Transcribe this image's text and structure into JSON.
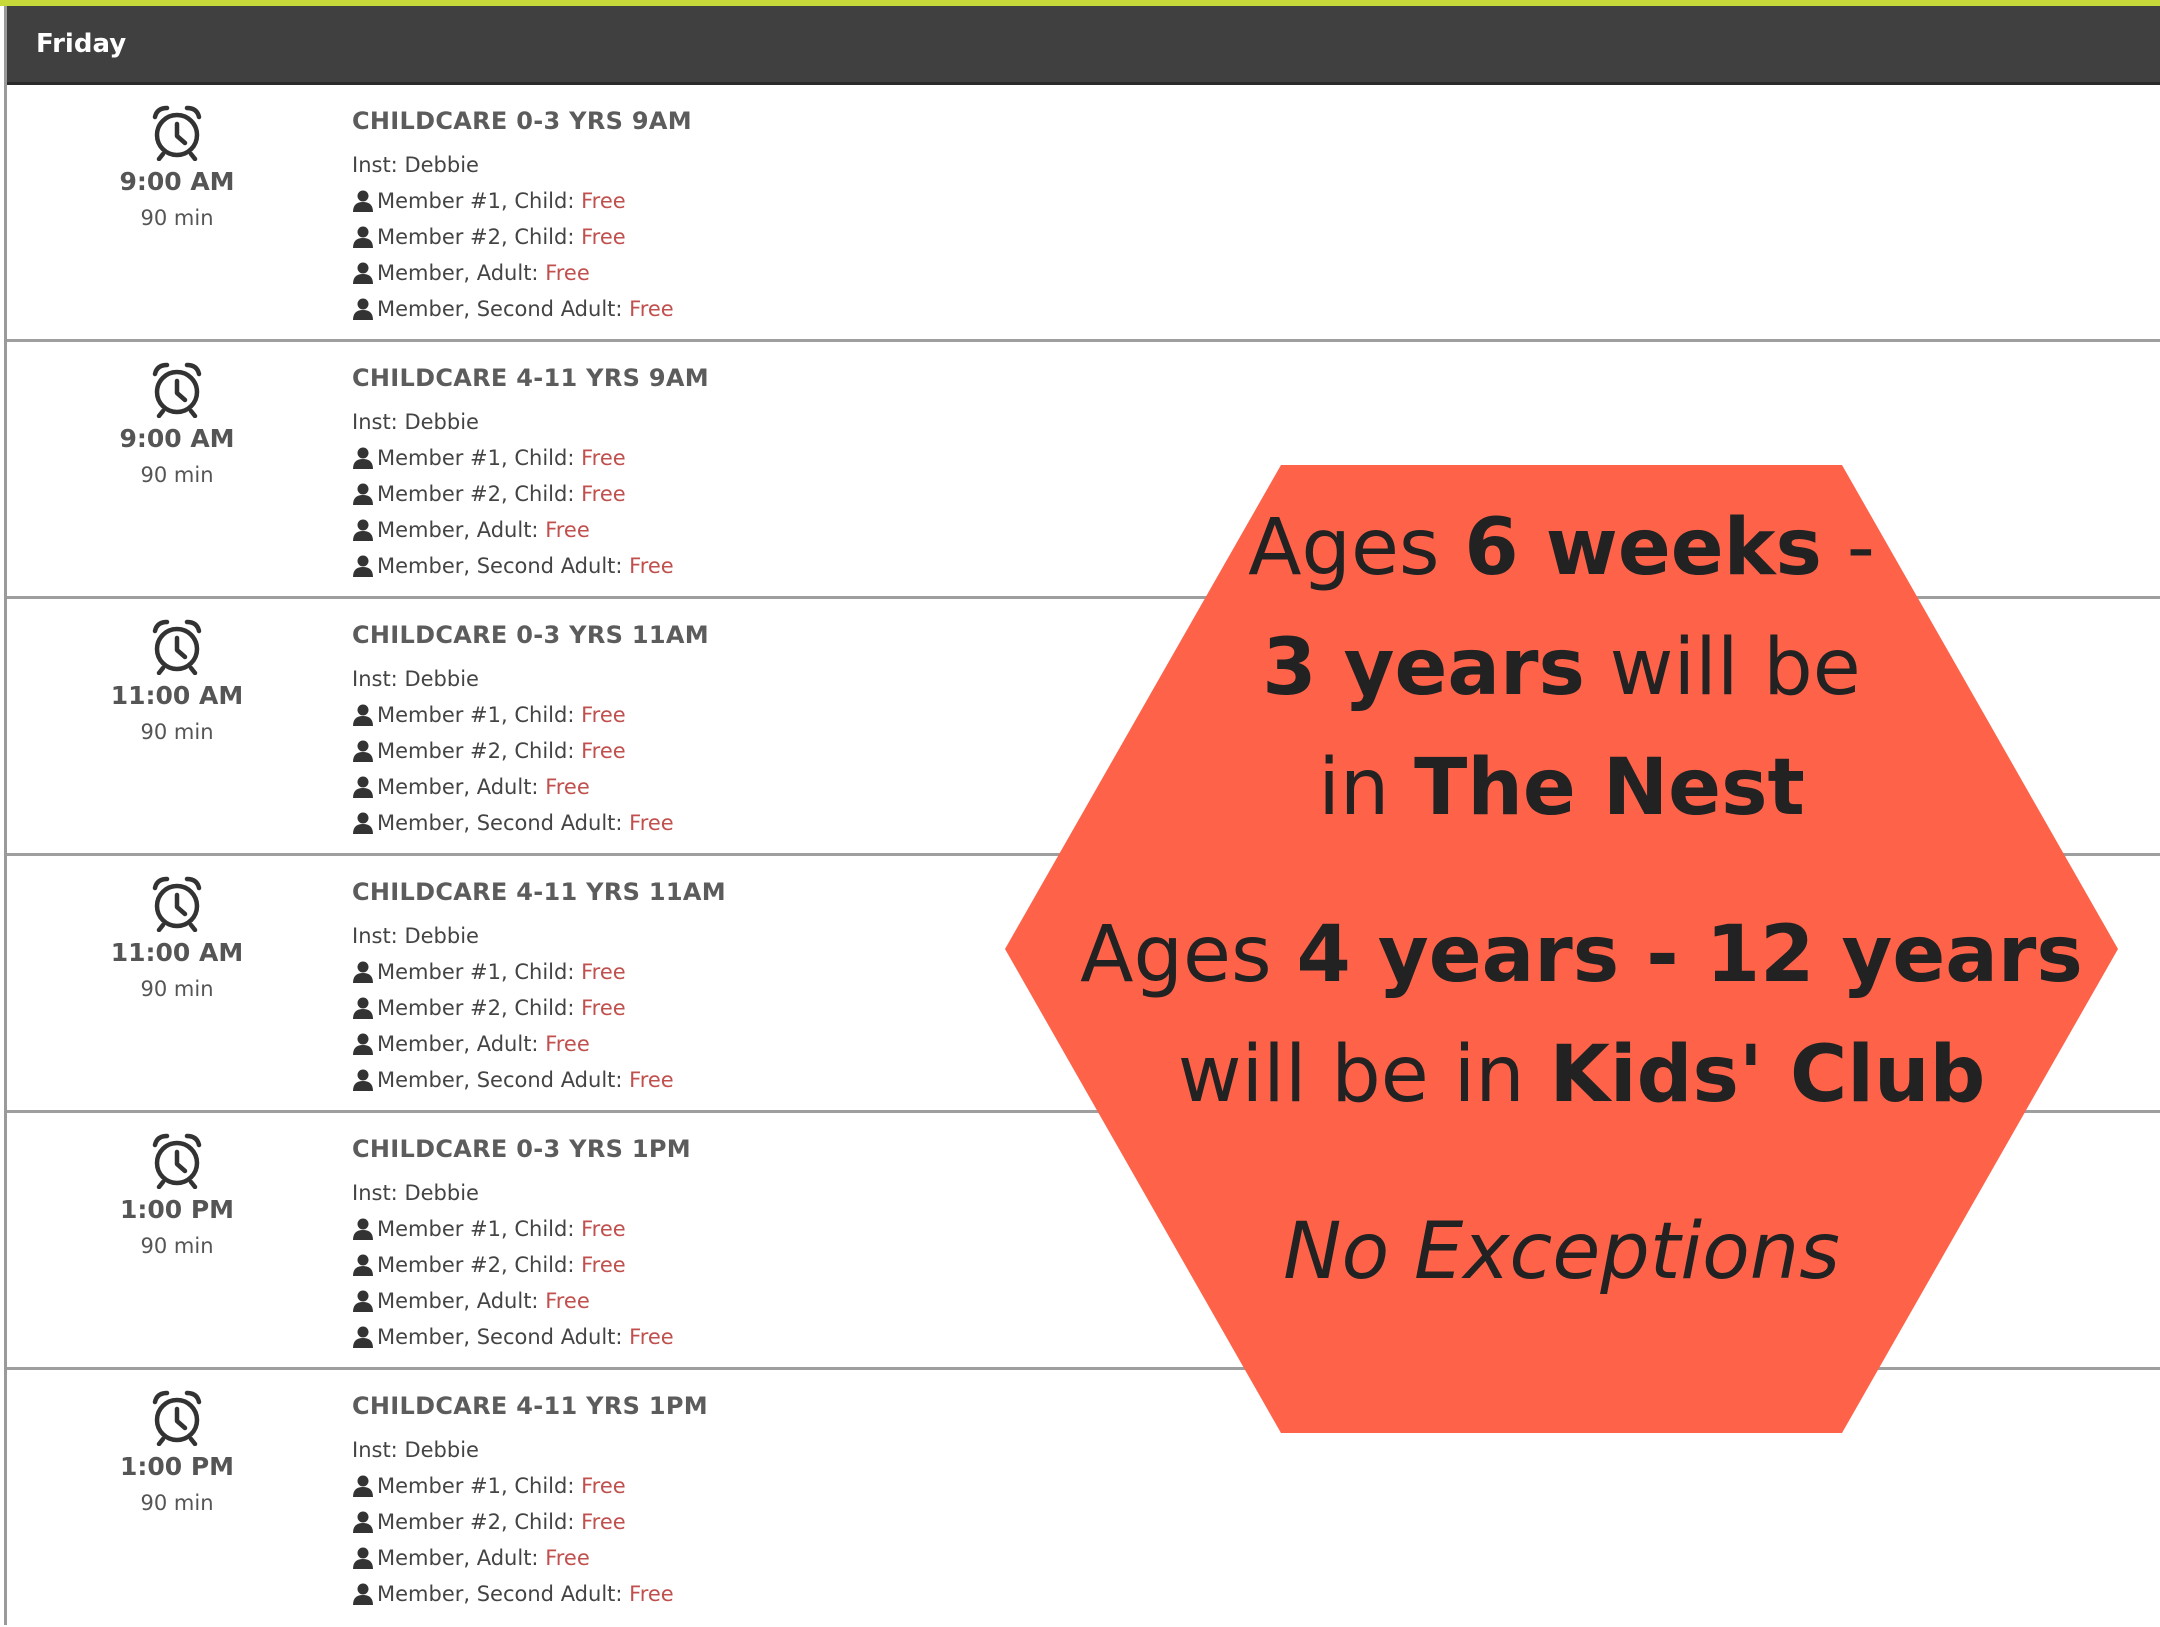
{
  "day": "Friday",
  "price_label": "Free",
  "instructor_prefix": "Inst:",
  "classes": [
    {
      "title": "CHILDCARE 0-3 YRS 9AM",
      "time": "9:00 AM",
      "duration": "90 min",
      "instructor": "Debbie",
      "prices": [
        "Member #1, Child:",
        "Member #2, Child:",
        "Member, Adult:",
        "Member, Second Adult:"
      ]
    },
    {
      "title": "CHILDCARE 4-11 YRS 9AM",
      "time": "9:00 AM",
      "duration": "90 min",
      "instructor": "Debbie",
      "prices": [
        "Member #1, Child:",
        "Member #2, Child:",
        "Member, Adult:",
        "Member, Second Adult:"
      ]
    },
    {
      "title": "CHILDCARE 0-3 YRS 11AM",
      "time": "11:00 AM",
      "duration": "90 min",
      "instructor": "Debbie",
      "prices": [
        "Member #1, Child:",
        "Member #2, Child:",
        "Member, Adult:",
        "Member, Second Adult:"
      ]
    },
    {
      "title": "CHILDCARE 4-11 YRS 11AM",
      "time": "11:00 AM",
      "duration": "90 min",
      "instructor": "Debbie",
      "prices": [
        "Member #1, Child:",
        "Member #2, Child:",
        "Member, Adult:",
        "Member, Second Adult:"
      ]
    },
    {
      "title": "CHILDCARE 0-3 YRS 1PM",
      "time": "1:00 PM",
      "duration": "90 min",
      "instructor": "Debbie",
      "prices": [
        "Member #1, Child:",
        "Member #2, Child:",
        "Member, Adult:",
        "Member, Second Adult:"
      ]
    },
    {
      "title": "CHILDCARE 4-11 YRS 1PM",
      "time": "1:00 PM",
      "duration": "90 min",
      "instructor": "Debbie",
      "prices": [
        "Member #1, Child:",
        "Member #2, Child:",
        "Member, Adult:",
        "Member, Second Adult:"
      ]
    }
  ],
  "notice": {
    "line1": {
      "a": "Ages ",
      "b": "6 weeks",
      "c": " -"
    },
    "line2": {
      "a": "3 years",
      "b": " will be"
    },
    "line3": {
      "a": "in ",
      "b": "The Nest"
    },
    "line4": {
      "a": "Ages ",
      "b": "4 years - 12 years"
    },
    "line5": {
      "a": "will be in ",
      "b": "Kids' Club"
    },
    "line6": "No Exceptions",
    "color": "#fe6249"
  },
  "icons": {
    "clock": "alarm-clock-icon",
    "person": "person-icon"
  }
}
